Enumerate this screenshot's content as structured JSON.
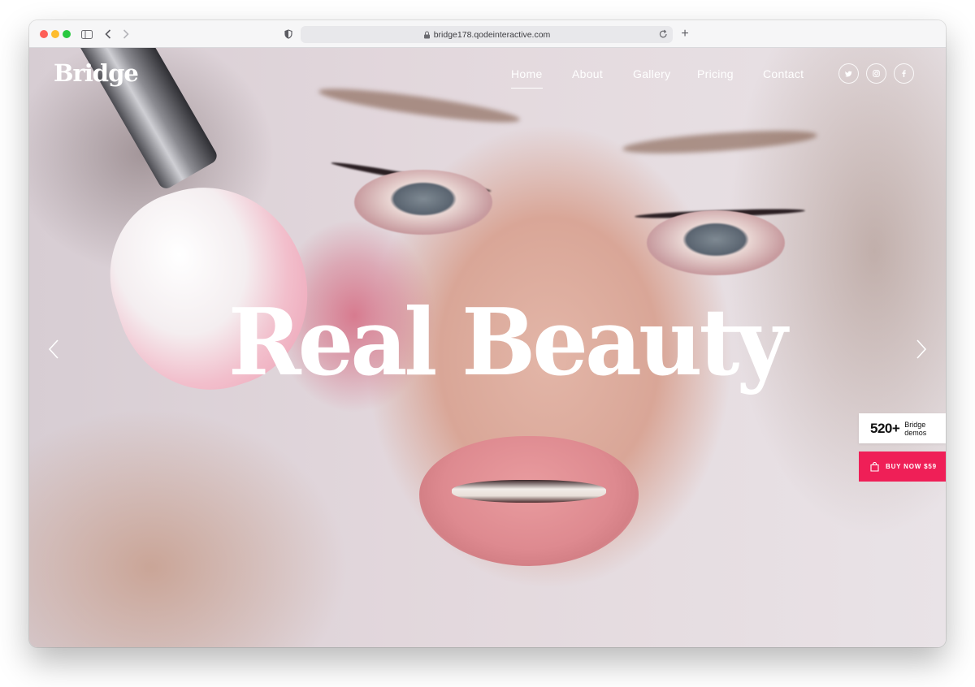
{
  "browser": {
    "url": "bridge178.qodeinteractive.com",
    "new_tab_label": "+"
  },
  "site": {
    "logo": "Bridge",
    "nav": [
      {
        "label": "Home",
        "active": true
      },
      {
        "label": "About",
        "active": false
      },
      {
        "label": "Gallery",
        "active": false
      },
      {
        "label": "Pricing",
        "active": false
      },
      {
        "label": "Contact",
        "active": false
      }
    ],
    "social_icons": [
      "twitter-icon",
      "instagram-icon",
      "facebook-icon"
    ]
  },
  "hero": {
    "headline": "Real Beauty"
  },
  "side_widgets": {
    "demos_count": "520+",
    "demos_label_line1": "Bridge",
    "demos_label_line2": "demos",
    "buy_label": "BUY NOW $59",
    "buy_color": "#ef1f57"
  }
}
